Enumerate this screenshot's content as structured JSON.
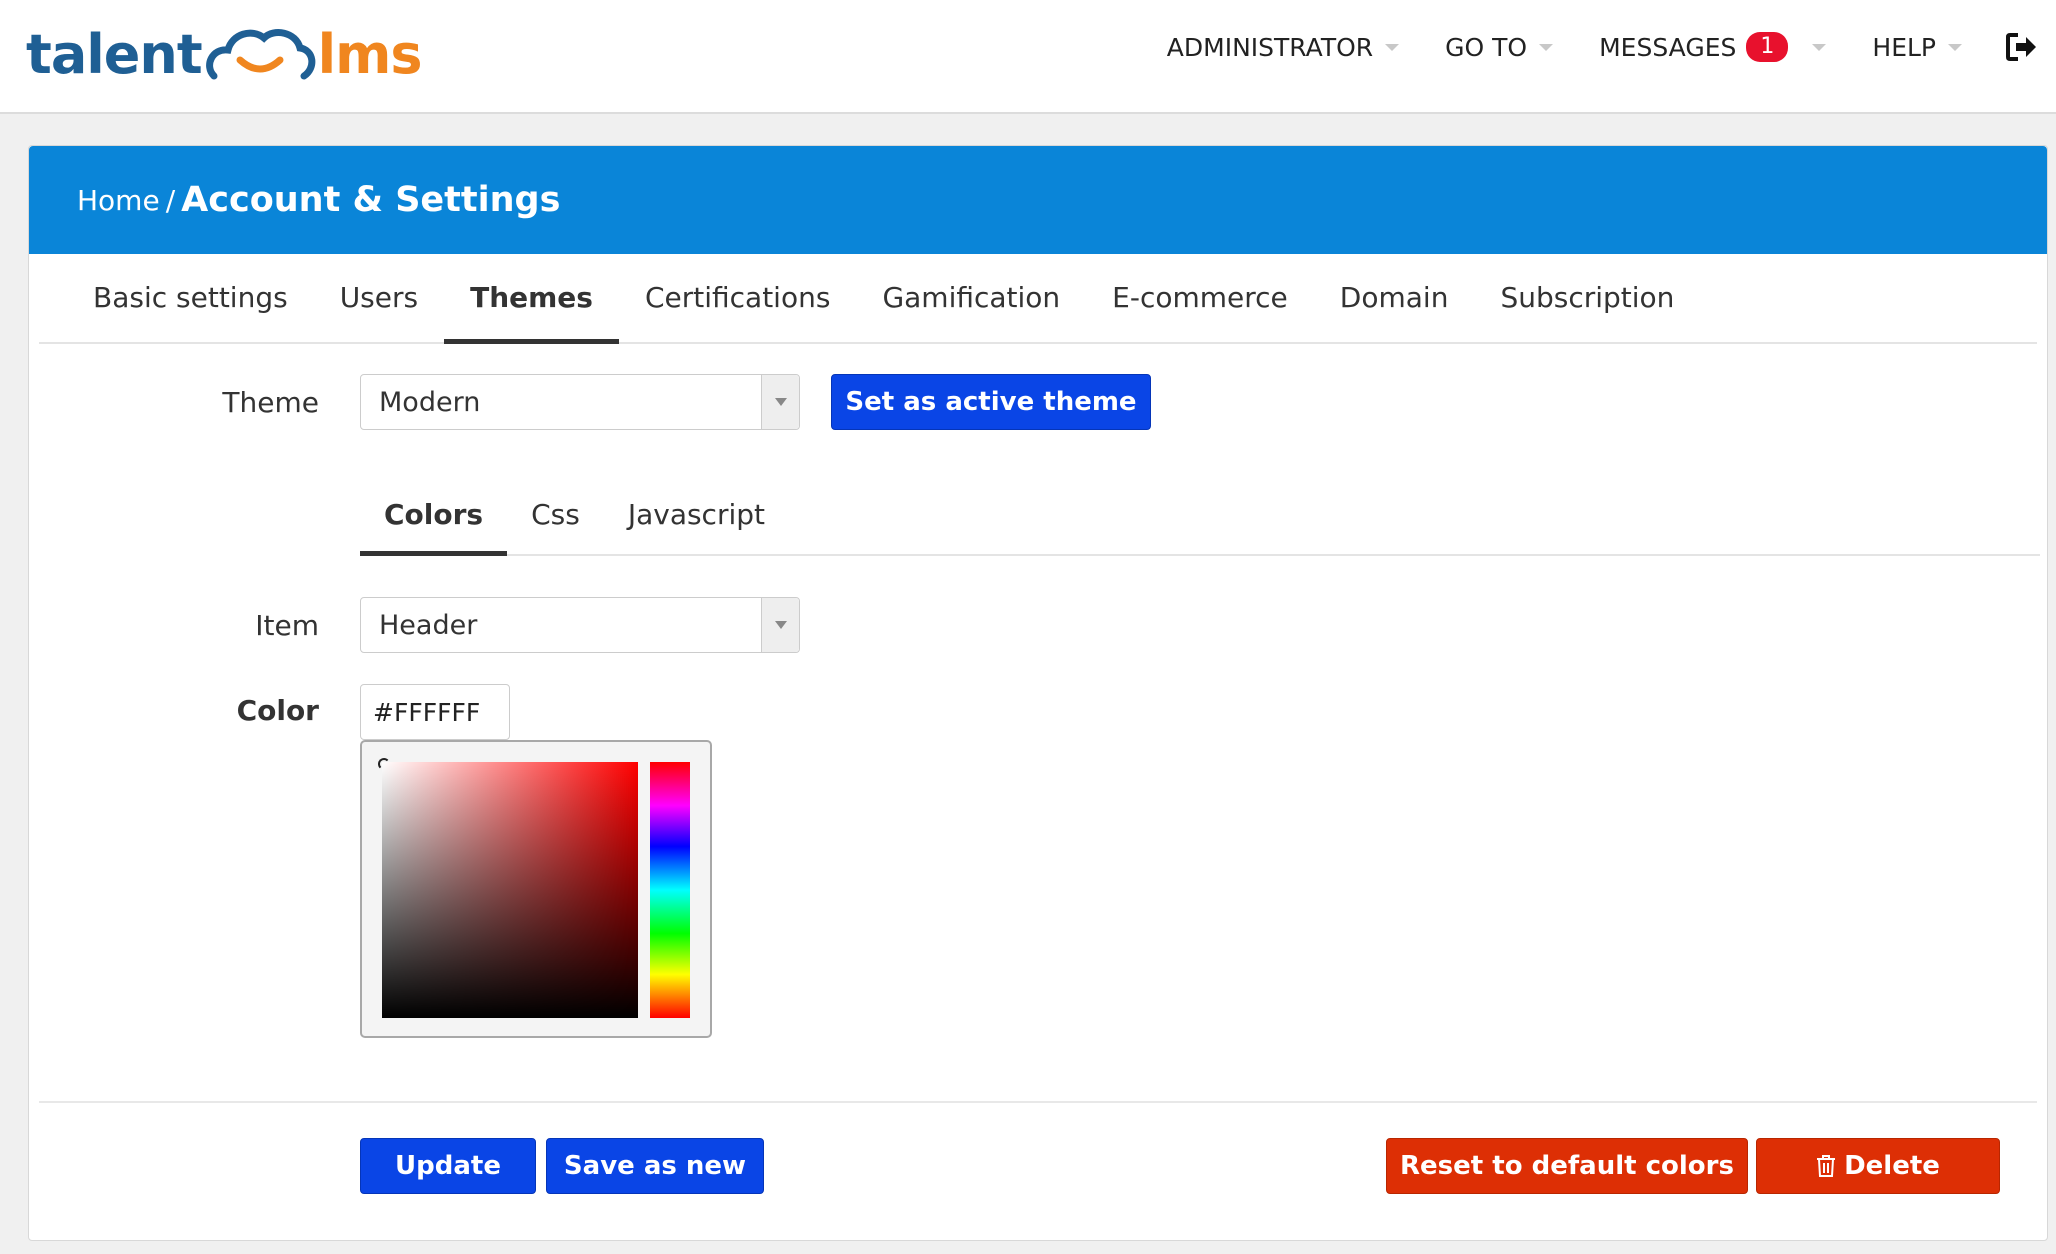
{
  "brand": {
    "logo_left": "talent",
    "logo_right": "lms",
    "color_blue": "#1f5f94",
    "color_orange": "#f0861f"
  },
  "topnav": {
    "administrator": "ADMINISTRATOR",
    "goto": "GO TO",
    "messages": "MESSAGES",
    "messages_count": "1",
    "help": "HELP",
    "logout_icon": "sign-out-icon"
  },
  "breadcrumb": {
    "home": "Home",
    "separator": "/",
    "current": "Account & Settings"
  },
  "main_tabs": [
    {
      "label": "Basic settings",
      "active": false
    },
    {
      "label": "Users",
      "active": false
    },
    {
      "label": "Themes",
      "active": true
    },
    {
      "label": "Certifications",
      "active": false
    },
    {
      "label": "Gamification",
      "active": false
    },
    {
      "label": "E-commerce",
      "active": false
    },
    {
      "label": "Domain",
      "active": false
    },
    {
      "label": "Subscription",
      "active": false
    }
  ],
  "theme_form": {
    "theme_label": "Theme",
    "theme_value": "Modern",
    "set_active_label": "Set as active theme"
  },
  "sub_tabs": [
    {
      "label": "Colors",
      "active": true
    },
    {
      "label": "Css",
      "active": false
    },
    {
      "label": "Javascript",
      "active": false
    }
  ],
  "colors_form": {
    "item_label": "Item",
    "item_value": "Header",
    "color_label": "Color",
    "color_value": "#FFFFFF"
  },
  "actions": {
    "update": "Update",
    "save_as_new": "Save as new",
    "reset": "Reset to default colors",
    "delete": "Delete"
  },
  "colors": {
    "header_bg": "#0a85d8",
    "primary_button": "#0a45e6",
    "danger_button": "#dd2f05",
    "badge": "#e8112d"
  }
}
